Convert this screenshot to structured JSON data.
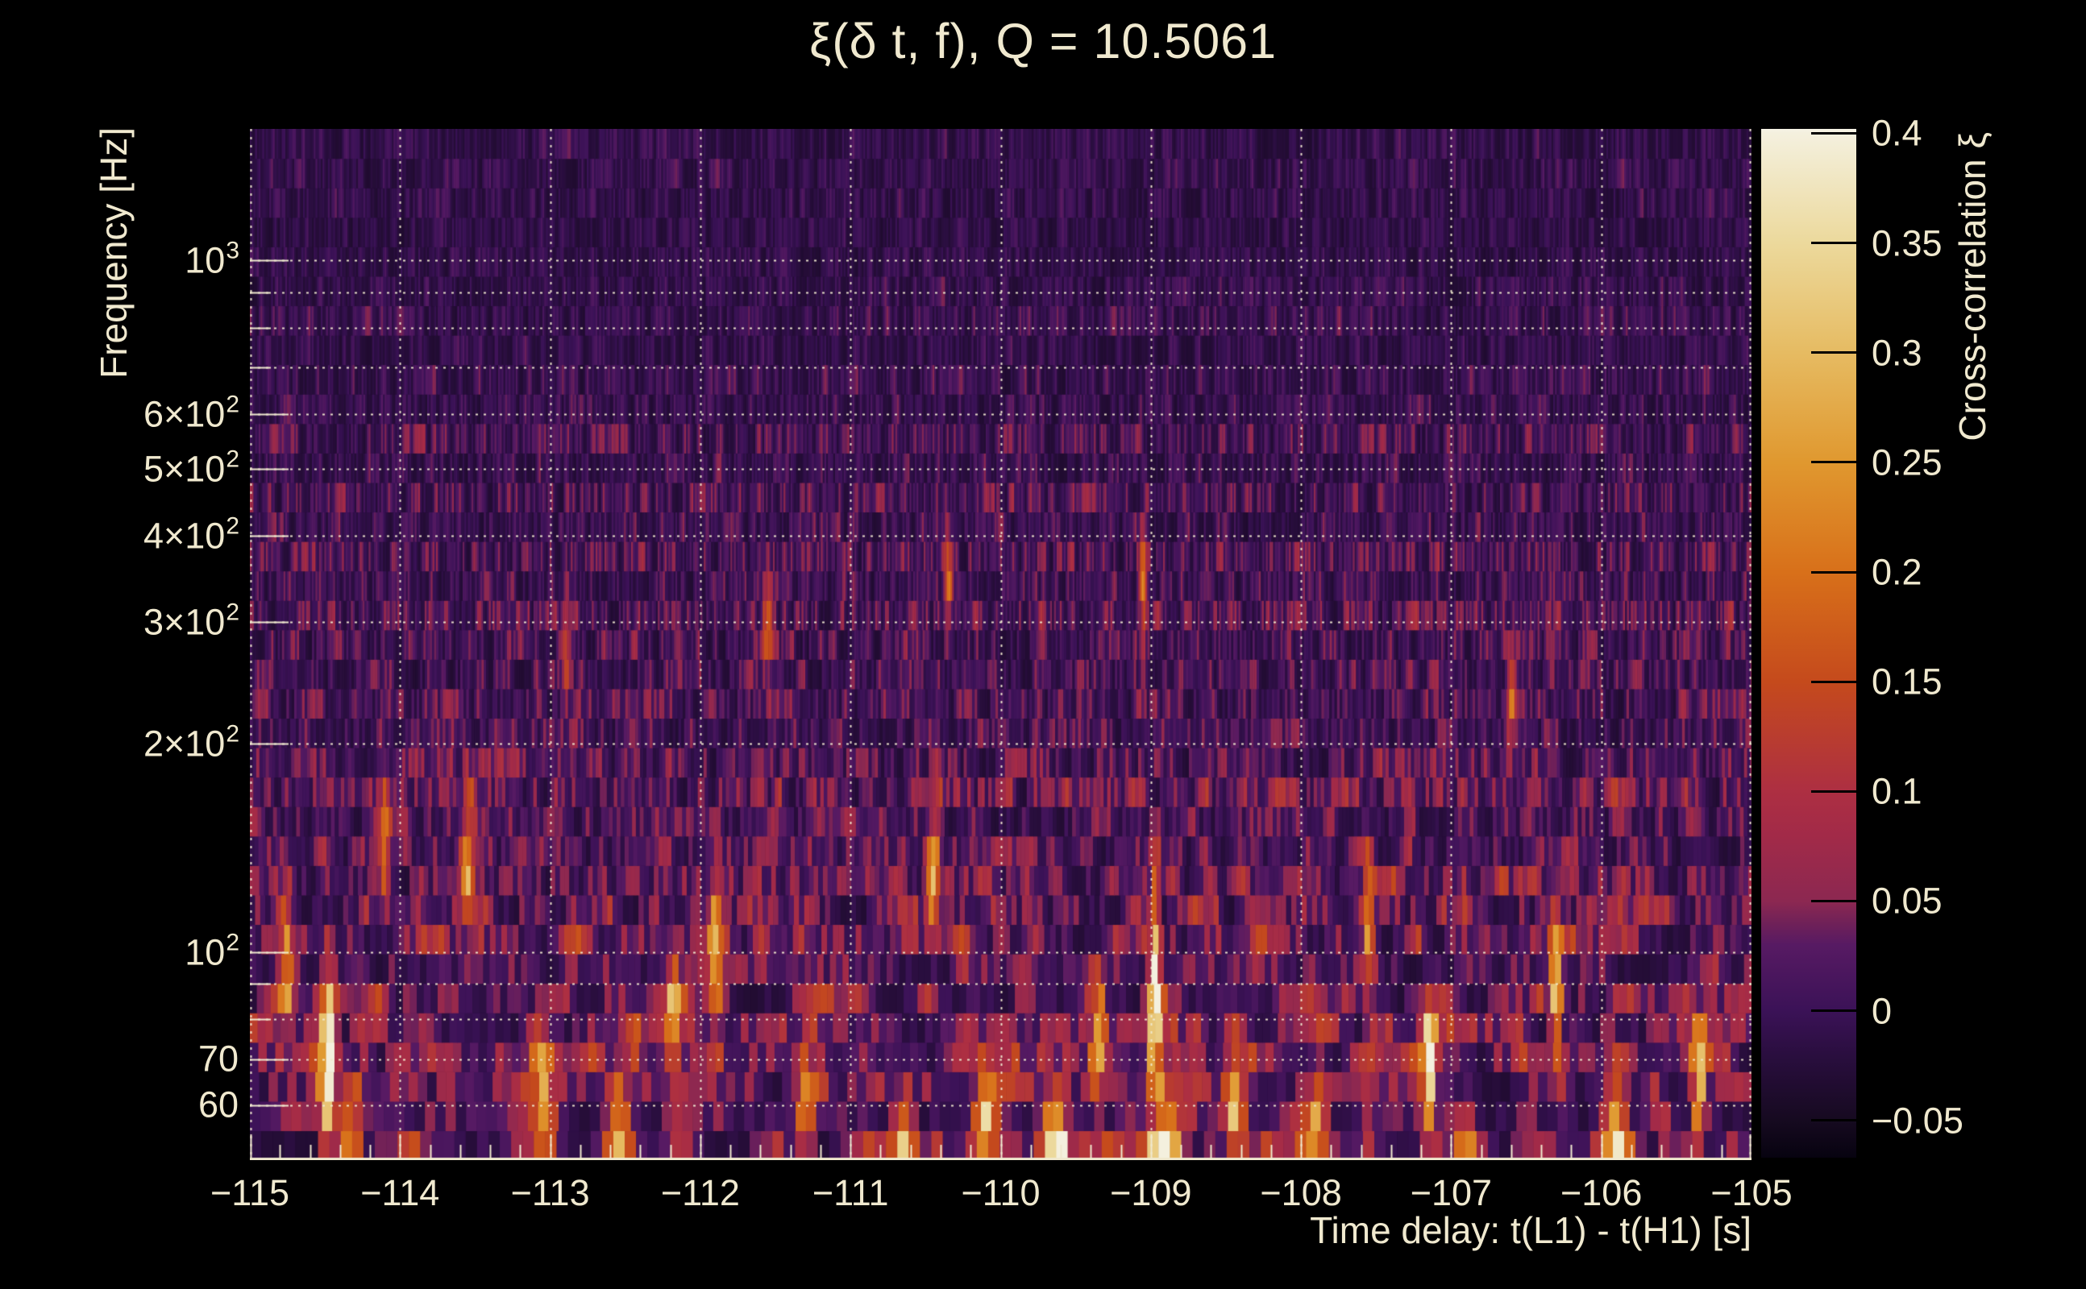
{
  "title": "ξ(δ t, f), Q = 10.5061",
  "colors": {
    "background": "#000000",
    "text": "#f0e9cf",
    "grid": "#f0e9cf",
    "axis": "#f0e9cf",
    "colorbar_tick": "#000000"
  },
  "axes": {
    "x": {
      "label": "Time delay: t(L1) - t(H1) [s]",
      "min": -115,
      "max": -105,
      "minor_step": 0.2,
      "ticks": [
        {
          "value": -115,
          "label": "−115"
        },
        {
          "value": -114,
          "label": "−114"
        },
        {
          "value": -113,
          "label": "−113"
        },
        {
          "value": -112,
          "label": "−112"
        },
        {
          "value": -111,
          "label": "−111"
        },
        {
          "value": -110,
          "label": "−110"
        },
        {
          "value": -109,
          "label": "−109"
        },
        {
          "value": -108,
          "label": "−108"
        },
        {
          "value": -107,
          "label": "−107"
        },
        {
          "value": -106,
          "label": "−106"
        },
        {
          "value": -105,
          "label": "−105"
        }
      ]
    },
    "y": {
      "label": "Frequency [Hz]",
      "scale": "log",
      "min": 50,
      "max": 1550,
      "tick_labels": [
        {
          "value": 1000,
          "base": "10",
          "sup": "3"
        },
        {
          "value": 600,
          "base": "6×10",
          "sup": "2"
        },
        {
          "value": 500,
          "base": "5×10",
          "sup": "2"
        },
        {
          "value": 400,
          "base": "4×10",
          "sup": "2"
        },
        {
          "value": 300,
          "base": "3×10",
          "sup": "2"
        },
        {
          "value": 200,
          "base": "2×10",
          "sup": "2"
        },
        {
          "value": 100,
          "base": "10",
          "sup": "2"
        },
        {
          "value": 70,
          "base": "70",
          "sup": ""
        },
        {
          "value": 60,
          "base": "60",
          "sup": ""
        }
      ],
      "gridlines": [
        60,
        70,
        80,
        90,
        100,
        200,
        300,
        400,
        500,
        600,
        700,
        800,
        900,
        1000
      ],
      "long_tick_values": [
        60,
        70,
        100,
        200,
        300,
        400,
        500,
        600,
        1000
      ],
      "short_tick_values": [
        80,
        90,
        700,
        800,
        900
      ]
    }
  },
  "colorbar": {
    "label": "Cross-correlation ξ",
    "min": -0.067,
    "max": 0.402,
    "ticks": [
      {
        "value": 0.4,
        "label": "0.4"
      },
      {
        "value": 0.35,
        "label": "0.35"
      },
      {
        "value": 0.3,
        "label": "0.3"
      },
      {
        "value": 0.25,
        "label": "0.25"
      },
      {
        "value": 0.2,
        "label": "0.2"
      },
      {
        "value": 0.15,
        "label": "0.15"
      },
      {
        "value": 0.1,
        "label": "0.1"
      },
      {
        "value": 0.05,
        "label": "0.05"
      },
      {
        "value": 0,
        "label": "0"
      },
      {
        "value": -0.05,
        "label": "−0.05"
      }
    ],
    "stops": [
      [
        -0.067,
        "#070310"
      ],
      [
        -0.05,
        "#160a20"
      ],
      [
        -0.02,
        "#2a0e3f"
      ],
      [
        0.0,
        "#3b1257"
      ],
      [
        0.03,
        "#571a63"
      ],
      [
        0.04,
        "#702158"
      ],
      [
        0.05,
        "#8c2851"
      ],
      [
        0.08,
        "#a22a48"
      ],
      [
        0.1,
        "#ad2f42"
      ],
      [
        0.15,
        "#c54a1c"
      ],
      [
        0.2,
        "#d8701a"
      ],
      [
        0.25,
        "#e0982f"
      ],
      [
        0.3,
        "#e6bb62"
      ],
      [
        0.35,
        "#ecd99c"
      ],
      [
        0.4,
        "#f4f0de"
      ],
      [
        0.402,
        "#f6f3e6"
      ]
    ]
  },
  "chart_data": {
    "type": "heatmap",
    "title": "ξ(δ t, f), Q = 10.5061",
    "q_value": 10.5061,
    "xlabel": "Time delay: t(L1) - t(H1) [s]",
    "ylabel": "Frequency [Hz]",
    "zlabel": "Cross-correlation ξ",
    "x_range": [
      -115,
      -105
    ],
    "y_range_hz": [
      50,
      1550
    ],
    "y_scale": "log",
    "value_range": [
      -0.067,
      0.402
    ],
    "description": "Q-transform style cross-correlation time-frequency map. Mostly dark purple noise (ξ ≈ −0.04…0.05) in vertical stripes; stripe time-width grows toward low frequency; variance and bright orange/yellow streaks concentrate below ~250 Hz.",
    "texture": {
      "seed": 20250514,
      "rows": 35,
      "col_width_k": 740,
      "col_width_min": 2.2,
      "col_width_max": 15,
      "base_floor": -0.035,
      "amp_high_f": 0.07,
      "amp_extra_low_f": 0.16,
      "noise_exp": 1.8,
      "smooth": 0.45,
      "value_cap": 0.4
    },
    "bright_events": [
      {
        "t": -114.75,
        "f": 95,
        "amp": 0.22,
        "st": 0.03,
        "sf": 0.06
      },
      {
        "t": -114.48,
        "f": 71,
        "amp": 0.46,
        "st": 0.035,
        "sf": 0.075
      },
      {
        "t": -114.32,
        "f": 54,
        "amp": 0.22,
        "st": 0.05,
        "sf": 0.05
      },
      {
        "t": -114.1,
        "f": 150,
        "amp": 0.17,
        "st": 0.03,
        "sf": 0.06
      },
      {
        "t": -113.55,
        "f": 135,
        "amp": 0.2,
        "st": 0.04,
        "sf": 0.06
      },
      {
        "t": -113.05,
        "f": 62,
        "amp": 0.27,
        "st": 0.05,
        "sf": 0.06
      },
      {
        "t": -112.9,
        "f": 280,
        "amp": 0.16,
        "st": 0.02,
        "sf": 0.05
      },
      {
        "t": -112.55,
        "f": 52,
        "amp": 0.28,
        "st": 0.06,
        "sf": 0.05
      },
      {
        "t": -112.18,
        "f": 80,
        "amp": 0.26,
        "st": 0.035,
        "sf": 0.06
      },
      {
        "t": -111.9,
        "f": 100,
        "amp": 0.27,
        "st": 0.03,
        "sf": 0.07
      },
      {
        "t": -111.55,
        "f": 300,
        "amp": 0.16,
        "st": 0.025,
        "sf": 0.05
      },
      {
        "t": -111.3,
        "f": 60,
        "amp": 0.26,
        "st": 0.045,
        "sf": 0.05
      },
      {
        "t": -110.65,
        "f": 52,
        "amp": 0.3,
        "st": 0.05,
        "sf": 0.05
      },
      {
        "t": -110.45,
        "f": 130,
        "amp": 0.22,
        "st": 0.03,
        "sf": 0.06
      },
      {
        "t": -110.35,
        "f": 350,
        "amp": 0.18,
        "st": 0.02,
        "sf": 0.05
      },
      {
        "t": -110.1,
        "f": 56,
        "amp": 0.3,
        "st": 0.06,
        "sf": 0.05
      },
      {
        "t": -109.63,
        "f": 52,
        "amp": 0.4,
        "st": 0.05,
        "sf": 0.045
      },
      {
        "t": -109.35,
        "f": 75,
        "amp": 0.28,
        "st": 0.03,
        "sf": 0.06
      },
      {
        "t": -109.05,
        "f": 350,
        "amp": 0.2,
        "st": 0.02,
        "sf": 0.05
      },
      {
        "t": -108.97,
        "f": 85,
        "amp": 0.5,
        "st": 0.022,
        "sf": 0.1
      },
      {
        "t": -108.9,
        "f": 52,
        "amp": 0.3,
        "st": 0.06,
        "sf": 0.05
      },
      {
        "t": -108.45,
        "f": 60,
        "amp": 0.27,
        "st": 0.04,
        "sf": 0.05
      },
      {
        "t": -107.9,
        "f": 56,
        "amp": 0.26,
        "st": 0.05,
        "sf": 0.05
      },
      {
        "t": -107.55,
        "f": 110,
        "amp": 0.22,
        "st": 0.03,
        "sf": 0.06
      },
      {
        "t": -107.15,
        "f": 68,
        "amp": 0.36,
        "st": 0.035,
        "sf": 0.07
      },
      {
        "t": -106.9,
        "f": 52,
        "amp": 0.24,
        "st": 0.05,
        "sf": 0.04
      },
      {
        "t": -106.6,
        "f": 240,
        "amp": 0.18,
        "st": 0.02,
        "sf": 0.05
      },
      {
        "t": -106.3,
        "f": 90,
        "amp": 0.28,
        "st": 0.03,
        "sf": 0.06
      },
      {
        "t": -105.9,
        "f": 55,
        "amp": 0.3,
        "st": 0.05,
        "sf": 0.05
      },
      {
        "t": -105.35,
        "f": 65,
        "amp": 0.26,
        "st": 0.035,
        "sf": 0.06
      }
    ]
  }
}
